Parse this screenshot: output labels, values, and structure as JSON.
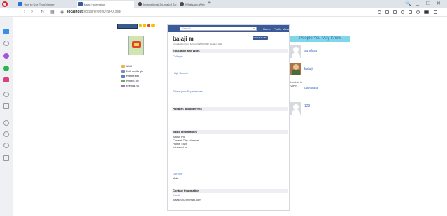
{
  "browser": {
    "tabs": [
      {
        "label": "How to Use TeamViewer"
      },
      {
        "label": "balaji information"
      },
      {
        "label": "International Journal of Sci"
      },
      {
        "label": "WhatsApp Web"
      }
    ],
    "url_host": "localhost",
    "url_path": "/socialnetwork/INFO.php",
    "window": {
      "minimize": "_",
      "restore": "❐",
      "close": "✕",
      "search": "🔍"
    }
  },
  "left_panel": {
    "links": [
      {
        "label": "Wall"
      },
      {
        "label": "Edit profile pic"
      },
      {
        "label": "Profile Info"
      },
      {
        "label": "Photos (0)"
      },
      {
        "label": "Friends (0)"
      }
    ]
  },
  "topnav": {
    "search_placeholder": "Search",
    "search_clear": "x",
    "items": [
      {
        "label": "Home"
      },
      {
        "label": "Profile"
      },
      {
        "label": "Account"
      }
    ]
  },
  "profile": {
    "name": "balaji m",
    "edit_button": "Edit My Profile",
    "meta": "Lives in chennai | Born on 04/05/2003 | Gender: Male"
  },
  "sections": {
    "education_title": "Education and Work",
    "college": "College",
    "high_school": "High School",
    "share_experiences": "Share your Experiences",
    "hobbies_title": "Hobbies and Interests",
    "basic_title": "Basic Information",
    "basic_lines": [
      "About You",
      "Current City: channai",
      "Home Town",
      "Intrested In"
    ],
    "gender_label": "Gender",
    "gender_value": "Male",
    "contact_title": "Contact Information",
    "email_label": "Email",
    "email_value": "balaji2003@gmail.com"
  },
  "people_you_may_know": {
    "title": "People You May Know",
    "friends": [
      {
        "name": "sundara"
      },
      {
        "name": "balaji"
      },
      {
        "name": "dayaraja",
        "alt": "Unable to View"
      },
      {
        "name": "123"
      }
    ]
  },
  "colors": {
    "brand_blue": "#3b5a9a",
    "link_blue": "#4a6fc4",
    "pymk_bg": "#7fd7e8"
  }
}
